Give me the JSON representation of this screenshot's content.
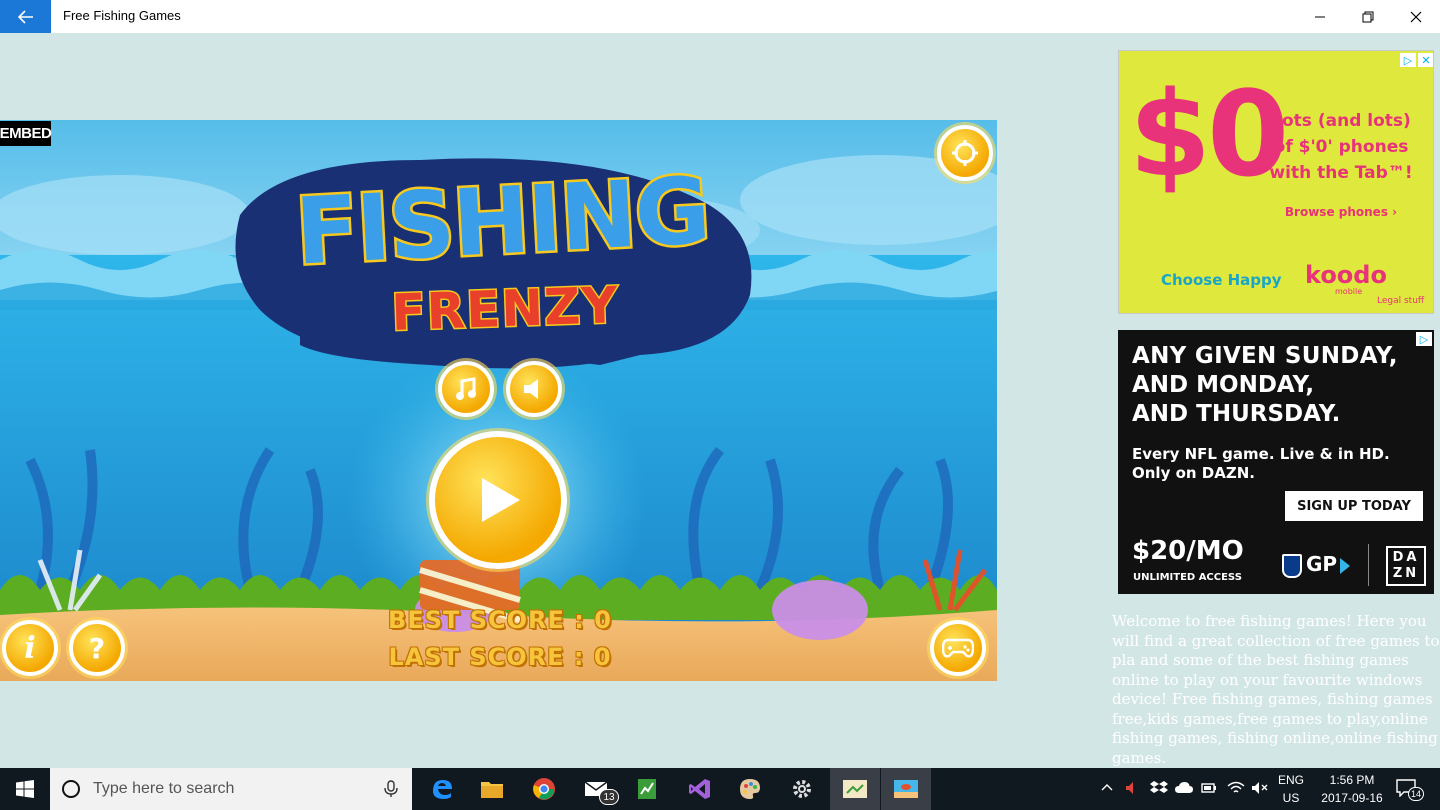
{
  "window": {
    "title": "Free Fishing Games"
  },
  "game": {
    "embed_label": "EMBED",
    "title_line1": "FISHING",
    "title_line2": "FRENZY",
    "best_score_label": "BEST SCORE : 0",
    "last_score_label": "LAST SCORE : 0"
  },
  "ads": {
    "koodo": {
      "big_text": "$0",
      "headline_1": "Lots (and lots)",
      "headline_2": "of $'0' phones",
      "headline_3": "with the Tab™!",
      "cta": "Browse phones ›",
      "slogan": "Choose Happy",
      "brand": "koodo",
      "brand_sub": "mobile",
      "legal": "Legal stuff"
    },
    "dazn": {
      "headline_1": "ANY GIVEN SUNDAY,",
      "headline_2": "AND MONDAY,",
      "headline_3": "AND THURSDAY.",
      "sub_1": "Every NFL game. Live & in HD.",
      "sub_2": "Only on DAZN.",
      "cta": "SIGN UP TODAY",
      "price": "$20/MO",
      "price_sub": "UNLIMITED ACCESS",
      "gp": "GP",
      "brand_top": "DA",
      "brand_bottom": "ZN"
    }
  },
  "description": "Welcome to free fishing games! Here you will find a great collection of free games to pla and some of the best fishing games online to play on your favourite windows device! Free fishing games, fishing games free,kids games,free games to play,online fishing games, fishing online,online fishing games.",
  "taskbar": {
    "search_placeholder": "Type here to search",
    "mail_badge": "13",
    "lang_top": "ENG",
    "lang_bottom": "US",
    "time": "1:56 PM",
    "date": "2017-09-16",
    "notification_count": "14"
  },
  "colors": {
    "accent": "#1b78d6",
    "page_bg": "#d3e6e6",
    "taskbar_bg": "#101820",
    "koodo_ad_bg": "#dfe83c",
    "koodo_pink": "#e8337a",
    "dazn_bg": "#111111"
  }
}
